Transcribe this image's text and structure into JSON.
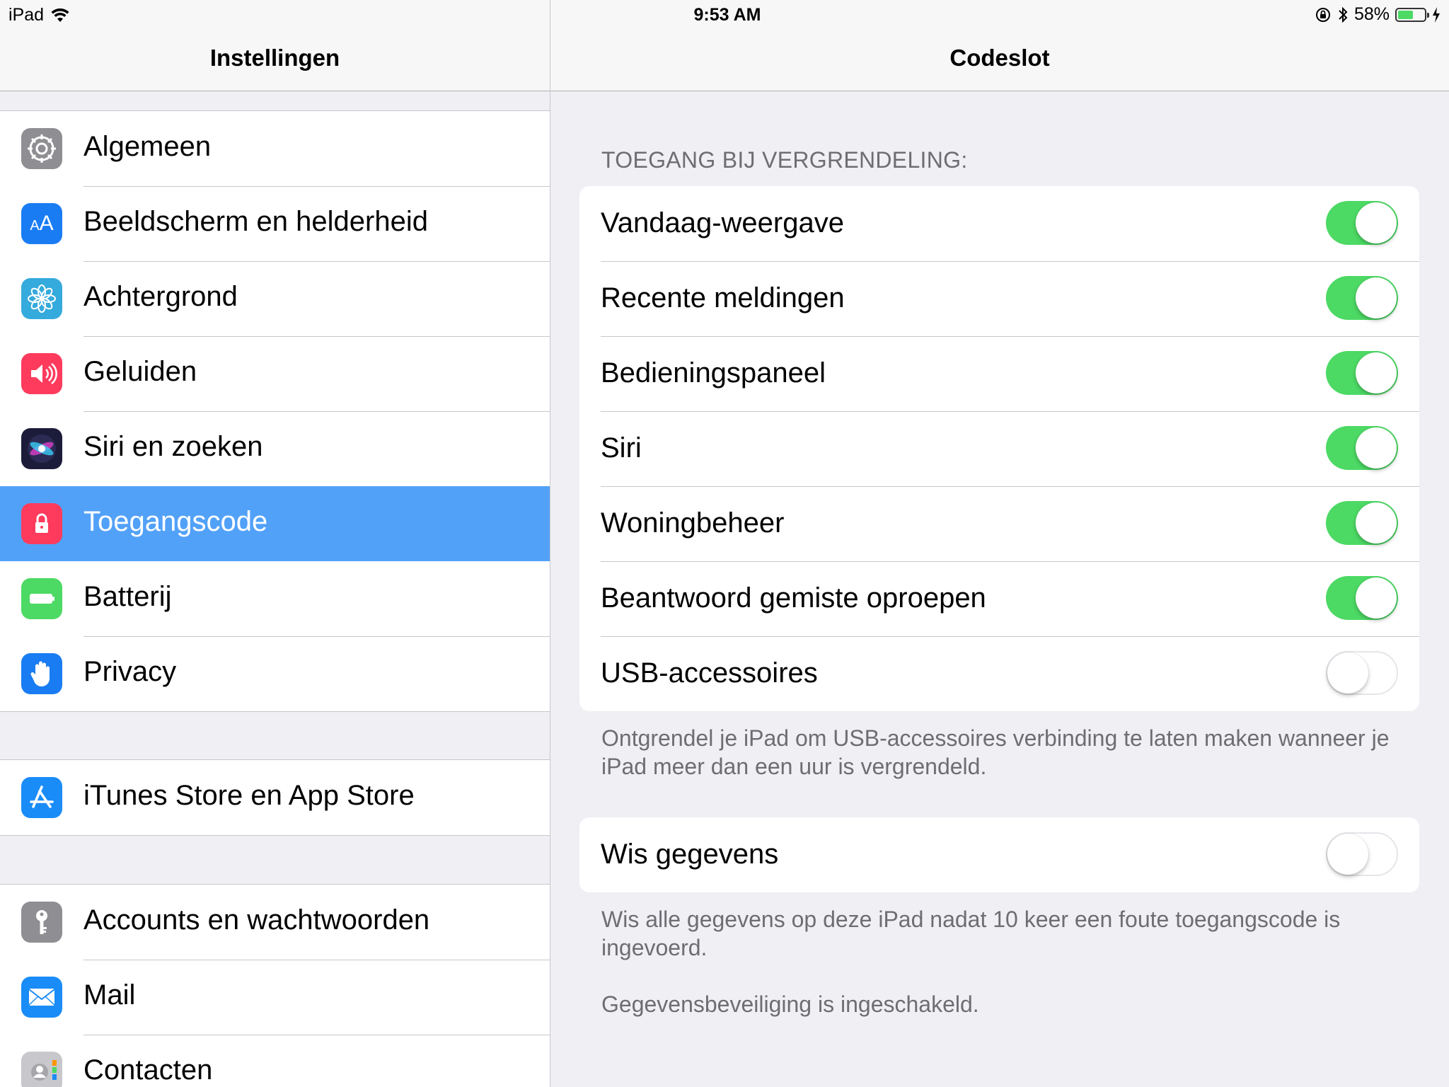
{
  "status_bar": {
    "device": "iPad",
    "time": "9:53 AM",
    "battery_percent": "58%",
    "battery_level": 0.58,
    "icons": [
      "wifi-icon",
      "orientation-lock-icon",
      "bluetooth-icon",
      "battery-icon",
      "charging-icon"
    ]
  },
  "master": {
    "title": "Instellingen",
    "groups": [
      {
        "items": [
          {
            "label": "Algemeen",
            "icon": "gear-icon",
            "color": "#8e8e93"
          },
          {
            "label": "Beeldscherm en helderheid",
            "icon": "text-size-icon",
            "color": "#1a7cf3"
          },
          {
            "label": "Achtergrond",
            "icon": "flower-icon",
            "color": "#35aadc"
          },
          {
            "label": "Geluiden",
            "icon": "speaker-icon",
            "color": "#fe3b5d"
          },
          {
            "label": "Siri en zoeken",
            "icon": "siri-icon",
            "color": "#1c1c3a"
          },
          {
            "label": "Toegangscode",
            "icon": "lock-icon",
            "color": "#fe3b5d",
            "selected": true
          },
          {
            "label": "Batterij",
            "icon": "battery-icon",
            "color": "#4cd964"
          },
          {
            "label": "Privacy",
            "icon": "hand-icon",
            "color": "#1a7cf3"
          }
        ]
      },
      {
        "items": [
          {
            "label": "iTunes Store en App Store",
            "icon": "app-store-icon",
            "color": "#1a8cf7"
          }
        ]
      },
      {
        "items": [
          {
            "label": "Accounts en wachtwoorden",
            "icon": "key-icon",
            "color": "#8e8e93"
          },
          {
            "label": "Mail",
            "icon": "envelope-icon",
            "color": "#1a8cf7"
          },
          {
            "label": "Contacten",
            "icon": "contacts-icon",
            "color": "#c7c7cc"
          }
        ]
      }
    ]
  },
  "detail": {
    "title": "Codeslot",
    "section_header": "TOEGANG BIJ VERGRENDELING:",
    "lock_items": [
      {
        "label": "Vandaag-weergave",
        "on": true
      },
      {
        "label": "Recente meldingen",
        "on": true
      },
      {
        "label": "Bedieningspaneel",
        "on": true
      },
      {
        "label": "Siri",
        "on": true
      },
      {
        "label": "Woningbeheer",
        "on": true
      },
      {
        "label": "Beantwoord gemiste oproepen",
        "on": true
      },
      {
        "label": "USB-accessoires",
        "on": false
      }
    ],
    "usb_footer": "Ontgrendel je iPad om USB-accessoires verbinding te laten maken wanneer je iPad meer dan een uur is vergrendeld.",
    "erase": {
      "label": "Wis gegevens",
      "on": false
    },
    "erase_footer": "Wis alle gegevens op deze iPad nadat 10 keer een foute toegangscode is ingevoerd.",
    "protection_footer": "Gegevensbeveiliging is ingeschakeld."
  }
}
